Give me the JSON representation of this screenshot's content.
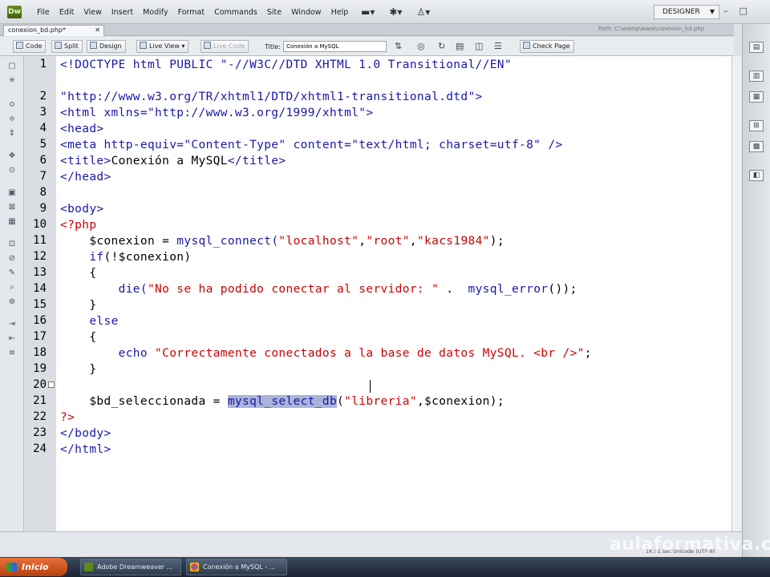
{
  "app": {
    "logo_text": "Dw",
    "menus": [
      "File",
      "Edit",
      "View",
      "Insert",
      "Modify",
      "Format",
      "Commands",
      "Site",
      "Window",
      "Help"
    ],
    "workspace": "DESIGNER",
    "window_buttons": [
      "–",
      "□"
    ]
  },
  "document": {
    "tab_label": "conexion_bd.php*",
    "path": "Path: C:\\wamp\\www\\conexion_bd.php",
    "view_buttons": [
      "Code",
      "Split",
      "Design"
    ],
    "live_view_label": "Live View",
    "live_code_label": "Live Code",
    "title_label": "Title:",
    "title_value": "Conexión a MySQL",
    "check_page_label": "Check Page"
  },
  "code": {
    "line_numbers": [
      "1",
      "2",
      "3",
      "4",
      "5",
      "6",
      "7",
      "8",
      "9",
      "10",
      "11",
      "12",
      "13",
      "14",
      "15",
      "16",
      "17",
      "18",
      "19",
      "20",
      "21",
      "22",
      "23",
      "24"
    ],
    "lines": [
      [
        {
          "t": "<!DOCTYPE html PUBLIC \"-//W3C//DTD XHTML 1.0 Transitional//EN\"",
          "c": "blue"
        }
      ],
      [
        {
          "t": "\"http://www.w3.org/TR/xhtml1/DTD/xhtml1-transitional.dtd\">",
          "c": "blue"
        }
      ],
      [
        {
          "t": "<html xmlns=\"http://www.w3.org/1999/xhtml\">",
          "c": "blue"
        }
      ],
      [
        {
          "t": "<head>",
          "c": "blue"
        }
      ],
      [
        {
          "t": "<meta http-equiv=\"Content-Type\" content=\"text/html; charset=utf-8\" />",
          "c": "blue"
        }
      ],
      [
        {
          "t": "<title>",
          "c": "blue"
        },
        {
          "t": "Conexión a MySQL",
          "c": "plain"
        },
        {
          "t": "</title>",
          "c": "blue"
        }
      ],
      [
        {
          "t": "</head>",
          "c": "blue"
        }
      ],
      [
        {
          "t": "",
          "c": "plain"
        }
      ],
      [
        {
          "t": "<body>",
          "c": "blue"
        }
      ],
      [
        {
          "t": "<?php",
          "c": "red"
        }
      ],
      [
        {
          "t": "    $conexion = ",
          "c": "plain"
        },
        {
          "t": "mysql_connect(",
          "c": "blue"
        },
        {
          "t": "\"localhost\"",
          "c": "red"
        },
        {
          "t": ",",
          "c": "plain"
        },
        {
          "t": "\"root\"",
          "c": "red"
        },
        {
          "t": ",",
          "c": "plain"
        },
        {
          "t": "\"kacs1984\"",
          "c": "red"
        },
        {
          "t": ");",
          "c": "plain"
        }
      ],
      [
        {
          "t": "    ",
          "c": "plain"
        },
        {
          "t": "if",
          "c": "blue"
        },
        {
          "t": "(!$conexion)",
          "c": "plain"
        }
      ],
      [
        {
          "t": "    {",
          "c": "plain"
        }
      ],
      [
        {
          "t": "        ",
          "c": "plain"
        },
        {
          "t": "die(",
          "c": "blue"
        },
        {
          "t": "\"No se ha podido conectar al servidor: \"",
          "c": "red"
        },
        {
          "t": " .  ",
          "c": "plain"
        },
        {
          "t": "mysql_error",
          "c": "blue"
        },
        {
          "t": "());",
          "c": "plain"
        }
      ],
      [
        {
          "t": "    }",
          "c": "plain"
        }
      ],
      [
        {
          "t": "    ",
          "c": "plain"
        },
        {
          "t": "else",
          "c": "blue"
        }
      ],
      [
        {
          "t": "    {",
          "c": "plain"
        }
      ],
      [
        {
          "t": "        ",
          "c": "plain"
        },
        {
          "t": "echo",
          "c": "blue"
        },
        {
          "t": " \"Correctamente conectados a la base de datos MySQL. <br />\"",
          "c": "red"
        },
        {
          "t": ";",
          "c": "plain"
        }
      ],
      [
        {
          "t": "    }",
          "c": "plain"
        }
      ],
      [
        {
          "t": "",
          "c": "plain"
        }
      ],
      [
        {
          "t": "    $bd_seleccionada = ",
          "c": "plain"
        },
        {
          "t": "mysql_select_db",
          "c": "hl"
        },
        {
          "t": "(",
          "c": "plain"
        },
        {
          "t": "\"libreria\"",
          "c": "red"
        },
        {
          "t": ",$conexion);",
          "c": "plain"
        }
      ],
      [
        {
          "t": "?>",
          "c": "red"
        }
      ],
      [
        {
          "t": "</body>",
          "c": "blue"
        }
      ],
      [
        {
          "t": "</html>",
          "c": "blue"
        }
      ],
      [
        {
          "t": "",
          "c": "plain"
        }
      ]
    ],
    "row_for_line": [
      0,
      2,
      3,
      4,
      5,
      6,
      7,
      8,
      9,
      10,
      11,
      12,
      13,
      14,
      15,
      16,
      17,
      18,
      19,
      20,
      21,
      22,
      23,
      24
    ]
  },
  "status": {
    "text": "1K / 1 sec  Unicode (UTF-8)",
    "watermark": "aulaformativa.com"
  },
  "taskbar": {
    "start_label": "Inicio",
    "tasks": [
      "Adobe Dreamweaver ...",
      "Conexión a MySQL - ..."
    ]
  },
  "colors": {
    "keyword_blue": "#1818a8",
    "string_red": "#cc0000",
    "selection": "#aab4d8"
  }
}
